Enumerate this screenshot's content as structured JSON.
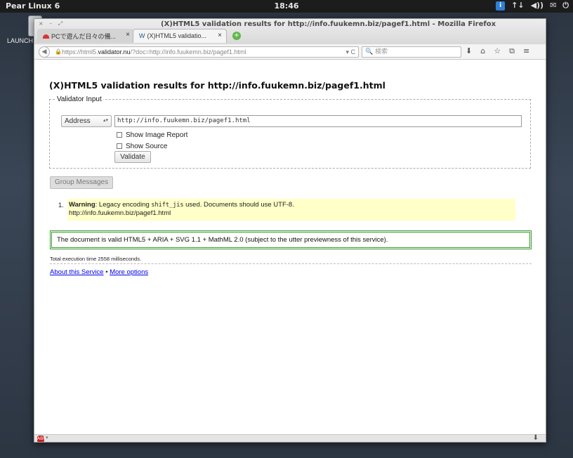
{
  "panel": {
    "distro": "Pear Linux 6",
    "clock": "18:46",
    "tray": [
      "↑↓",
      "◀))",
      "✉",
      "⏻"
    ],
    "tray_badge": "i"
  },
  "launcher": {
    "label": "LAUNCH"
  },
  "window": {
    "controls": "× – ⤢",
    "title": "(X)HTML5 validation results for http://info.fuukemn.biz/pagef1.html - Mozilla Firefox"
  },
  "tabs": [
    {
      "label": "PCで遊んだ日々の備...",
      "close": "×"
    },
    {
      "label": "(X)HTML5 validatio...",
      "close": "×",
      "favicon": "W"
    }
  ],
  "newtab": "+",
  "navbar": {
    "url_prefix": "https://html5.",
    "url_host": "validator.nu",
    "url_rest": "/?doc=http://info.fuukemn.biz/pagef1.html",
    "reload": "▾ C",
    "search_placeholder": "🔍 検索",
    "icons": [
      "⬇",
      "⌂",
      "☆",
      "⧉",
      "≡"
    ]
  },
  "page": {
    "heading": "(X)HTML5 validation results for http://info.fuukemn.biz/pagef1.html",
    "legend": "Validator Input",
    "select_value": "Address",
    "select_arrow": "▴▾",
    "url_value": "http://info.fuukemn.biz/pagef1.html",
    "show_image_report": "Show Image Report",
    "show_source": "Show Source",
    "validate_button": "Validate",
    "group_messages": "Group Messages",
    "warning_num": "1.",
    "warning_label": "Warning",
    "warning_text_a": ": Legacy encoding ",
    "warning_code": "shift_jis",
    "warning_text_b": " used. Documents should use UTF-8.",
    "warning_url": "http://info.fuukemn.biz/pagef1.html",
    "valid_message": "The document is valid HTML5 + ARIA + SVG 1.1 + MathML 2.0 (subject to the utter previewness of this service).",
    "exec_time": "Total execution time 2558 milliseconds.",
    "about_link": "About this Service",
    "separator": " • ",
    "more_link": "More options"
  },
  "statusbar": {
    "abp": "ABP",
    "abp_arrow": "▾",
    "download": "⬇"
  }
}
